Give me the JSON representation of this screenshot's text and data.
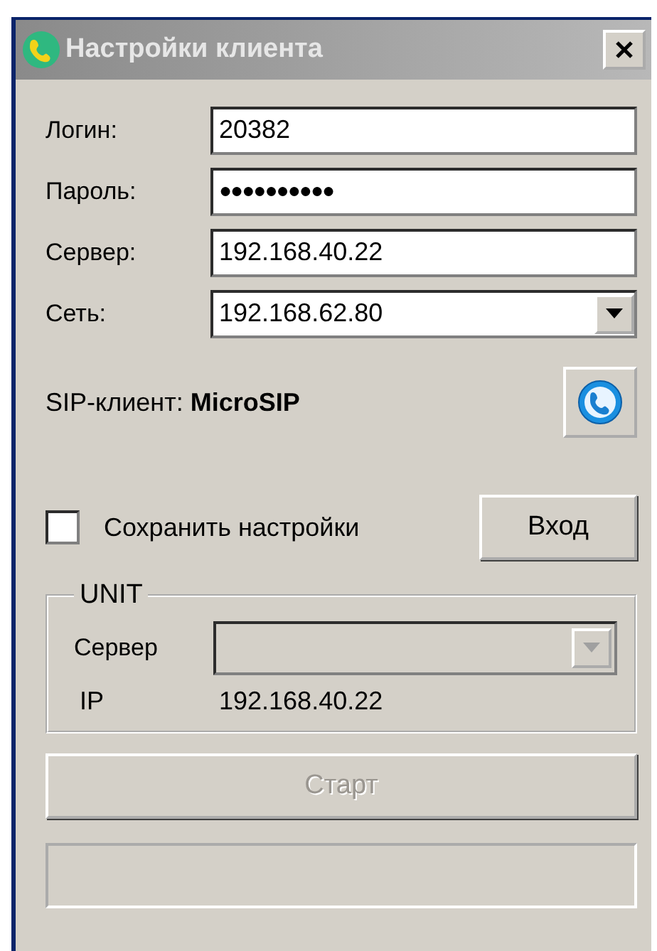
{
  "window": {
    "title": "Настройки клиента"
  },
  "fields": [
    {
      "kind": "text",
      "label": "Логин:",
      "value": "20382"
    },
    {
      "kind": "password",
      "label": "Пароль:",
      "value": "●●●●●●●●●●"
    },
    {
      "kind": "text",
      "label": "Сервер:",
      "value": "192.168.40.22"
    },
    {
      "kind": "select",
      "label": "Сеть:",
      "value": "192.168.62.80"
    }
  ],
  "sip_client": {
    "label": "SIP-клиент:",
    "name": "MicroSIP"
  },
  "save_settings": {
    "label": "Сохранить настройки",
    "checked": false
  },
  "login_button": {
    "label": "Вход"
  },
  "unit": {
    "title": "UNIT",
    "server_label": "Сервер",
    "server_disabled": true,
    "ip_label": "IP",
    "ip_value": "192.168.40.22"
  },
  "start_button": {
    "label": "Старт",
    "disabled": true
  }
}
